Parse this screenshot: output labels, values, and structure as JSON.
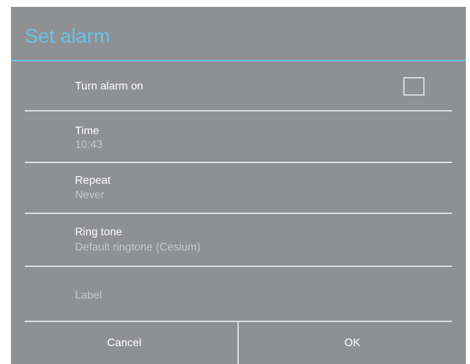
{
  "dialog": {
    "title": "Set alarm",
    "alarm_toggle": {
      "label": "Turn alarm on",
      "checked": false
    },
    "time": {
      "label": "Time",
      "value": "10:43"
    },
    "repeat": {
      "label": "Repeat",
      "value": "Never"
    },
    "ringtone": {
      "label": "Ring tone",
      "value": "Default ringtone (Cesium)"
    },
    "label_field": {
      "placeholder": "Label"
    },
    "buttons": {
      "cancel": "Cancel",
      "ok": "OK"
    }
  },
  "colors": {
    "dialog_background": "#8f9093",
    "title_accent": "#66c2e8",
    "separator": "#dfe0e2",
    "secondary_text": "#c7c8ca"
  }
}
